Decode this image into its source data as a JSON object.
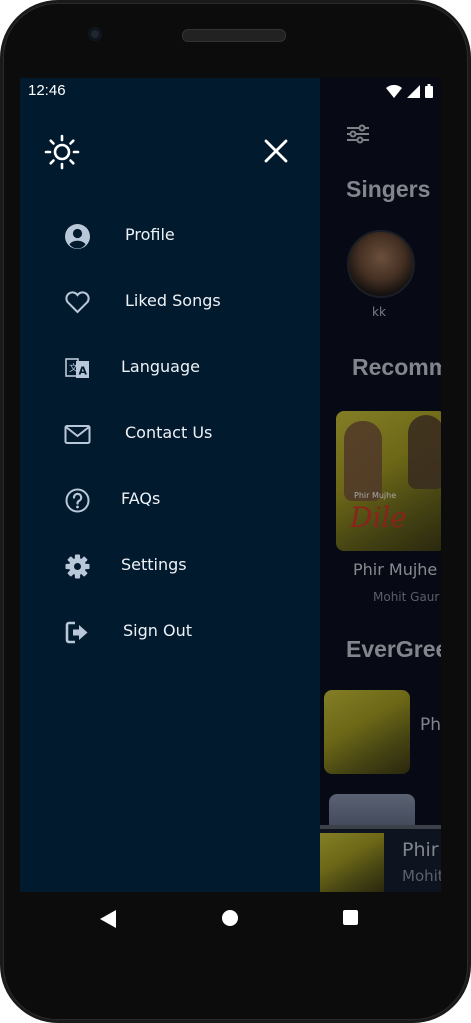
{
  "status_bar": {
    "time": "12:46"
  },
  "drawer": {
    "menu": [
      {
        "label": "Profile",
        "icon": "profile-icon"
      },
      {
        "label": "Liked Songs",
        "icon": "heart-icon"
      },
      {
        "label": "Language",
        "icon": "language-icon"
      },
      {
        "label": "Contact Us",
        "icon": "mail-icon"
      },
      {
        "label": "FAQs",
        "icon": "question-icon"
      },
      {
        "label": "Settings",
        "icon": "gear-icon"
      },
      {
        "label": "Sign Out",
        "icon": "sign-out-icon"
      }
    ]
  },
  "background": {
    "singers_title": "Singers",
    "singer_name": "kk",
    "recommended_title": "Recomm",
    "recommended_song_title": "Phir Mujhe D",
    "recommended_song_artist": "Mohit Gaur",
    "evergreen_title": "EverGree",
    "evergreen_song_title": "Ph",
    "album_art_text": "Phir Mujhe",
    "album_art_script": "Dile"
  },
  "mini_player": {
    "title": "Phir",
    "artist": "Mohit"
  },
  "colors": {
    "drawer_bg": "#021a2e",
    "app_bg": "#0b1020",
    "text": "#eef2f7"
  }
}
